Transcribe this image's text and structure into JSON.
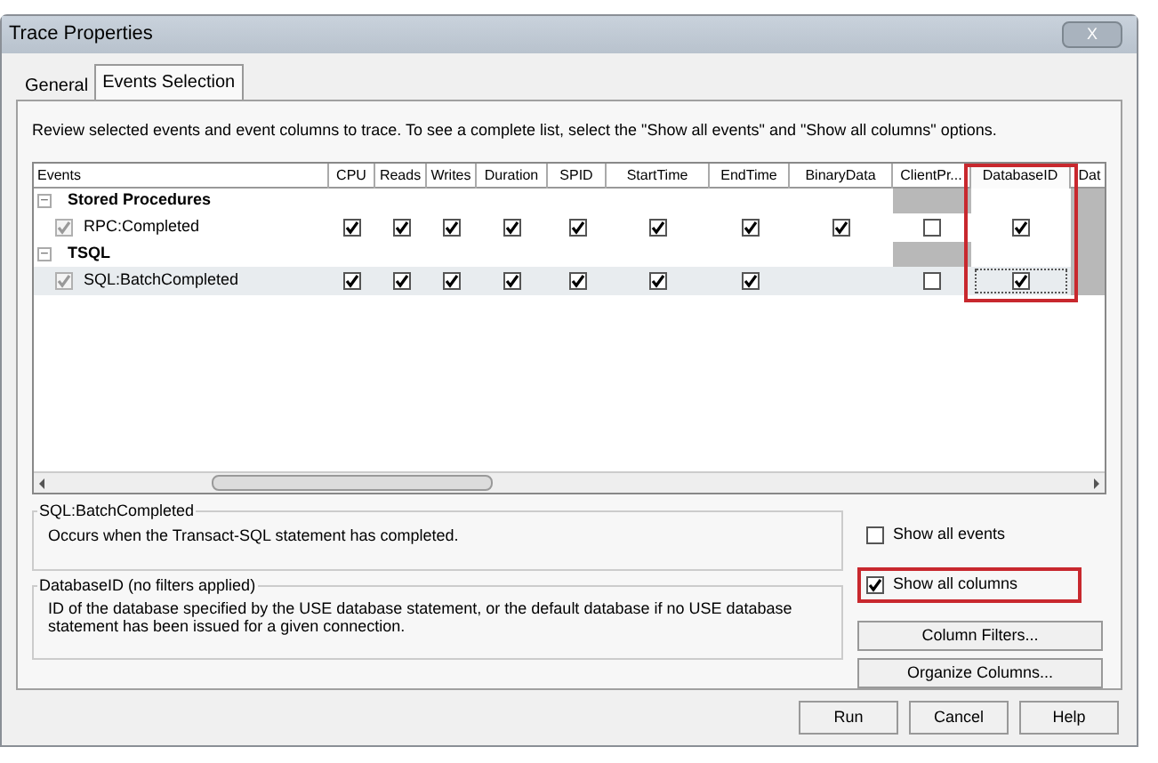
{
  "window": {
    "title": "Trace Properties",
    "close": "X"
  },
  "tabs": [
    {
      "label": "General",
      "selected": false
    },
    {
      "label": "Events Selection",
      "selected": true
    }
  ],
  "instructions": "Review selected events and event columns to trace. To see a complete list, select the \"Show all events\" and \"Show all columns\" options.",
  "grid": {
    "columns": [
      {
        "label": "Events",
        "shaded": false,
        "highlight": false
      },
      {
        "label": "CPU",
        "shaded": false,
        "highlight": false
      },
      {
        "label": "Reads",
        "shaded": false,
        "highlight": false
      },
      {
        "label": "Writes",
        "shaded": false,
        "highlight": false
      },
      {
        "label": "Duration",
        "shaded": false,
        "highlight": false
      },
      {
        "label": "SPID",
        "shaded": false,
        "highlight": false
      },
      {
        "label": "StartTime",
        "shaded": false,
        "highlight": false
      },
      {
        "label": "EndTime",
        "shaded": false,
        "highlight": false
      },
      {
        "label": "BinaryData",
        "shaded": false,
        "highlight": false
      },
      {
        "label": "ClientPr...",
        "shaded": true,
        "highlight": false
      },
      {
        "label": "DatabaseID",
        "shaded": false,
        "highlight": true
      },
      {
        "label": "Dat",
        "shaded": true,
        "highlight": false
      }
    ],
    "groups": [
      {
        "name": "Stored Procedures",
        "expander": "−",
        "expanded": true,
        "events": [
          {
            "name": "RPC:Completed",
            "checked": true,
            "selected": false,
            "cells": [
              {
                "kind": "check",
                "checked": true,
                "focused": false
              },
              {
                "kind": "check",
                "checked": true,
                "focused": false
              },
              {
                "kind": "check",
                "checked": true,
                "focused": false
              },
              {
                "kind": "check",
                "checked": true,
                "focused": false
              },
              {
                "kind": "check",
                "checked": true,
                "focused": false
              },
              {
                "kind": "check",
                "checked": true,
                "focused": false
              },
              {
                "kind": "check",
                "checked": true,
                "focused": false
              },
              {
                "kind": "check",
                "checked": true,
                "focused": false
              },
              {
                "kind": "check",
                "checked": false,
                "focused": false
              },
              {
                "kind": "check",
                "checked": true,
                "focused": false
              },
              {
                "kind": "blank"
              }
            ]
          }
        ]
      },
      {
        "name": "TSQL",
        "expander": "−",
        "expanded": true,
        "events": [
          {
            "name": "SQL:BatchCompleted",
            "checked": true,
            "selected": true,
            "cells": [
              {
                "kind": "check",
                "checked": true,
                "focused": false
              },
              {
                "kind": "check",
                "checked": true,
                "focused": false
              },
              {
                "kind": "check",
                "checked": true,
                "focused": false
              },
              {
                "kind": "check",
                "checked": true,
                "focused": false
              },
              {
                "kind": "check",
                "checked": true,
                "focused": false
              },
              {
                "kind": "check",
                "checked": true,
                "focused": false
              },
              {
                "kind": "check",
                "checked": true,
                "focused": false
              },
              {
                "kind": "blank"
              },
              {
                "kind": "check",
                "checked": false,
                "focused": false
              },
              {
                "kind": "check",
                "checked": true,
                "focused": true
              },
              {
                "kind": "blank"
              }
            ]
          }
        ]
      }
    ]
  },
  "event_description": {
    "title": "SQL:BatchCompleted",
    "text": "Occurs when the Transact-SQL statement has completed."
  },
  "options": [
    {
      "label": "Show all events",
      "checked": false,
      "highlight": false
    },
    {
      "label": "Show all columns",
      "checked": true,
      "highlight": true
    }
  ],
  "column_description": {
    "title": "DatabaseID (no filters applied)",
    "text": "ID of the database specified by the USE database statement, or the default database if no USE database statement has been issued for a given connection."
  },
  "side_buttons": [
    "Column Filters...",
    "Organize Columns..."
  ],
  "buttons": [
    "Run",
    "Cancel",
    "Help"
  ]
}
